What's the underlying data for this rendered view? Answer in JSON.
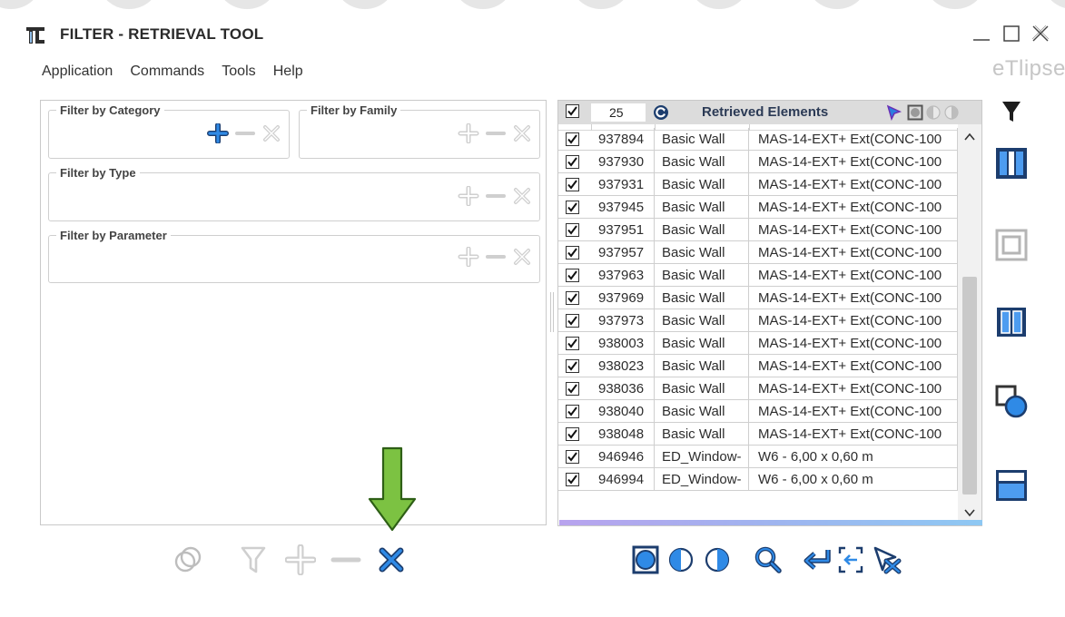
{
  "window": {
    "title": "FILTER - RETRIEVAL TOOL",
    "brand": "eTlipse"
  },
  "menu": [
    "Application",
    "Commands",
    "Tools",
    "Help"
  ],
  "filters": {
    "category": "Filter by Category",
    "family": "Filter by Family",
    "type": "Filter by Type",
    "parameter": "Filter by Parameter"
  },
  "grid": {
    "count": "25",
    "title": "Retrieved Elements",
    "rows": [
      {
        "id": "937894",
        "family": "Basic Wall",
        "type": "MAS-14-EXT+ Ext(CONC-100"
      },
      {
        "id": "937930",
        "family": "Basic Wall",
        "type": "MAS-14-EXT+ Ext(CONC-100"
      },
      {
        "id": "937931",
        "family": "Basic Wall",
        "type": "MAS-14-EXT+ Ext(CONC-100"
      },
      {
        "id": "937945",
        "family": "Basic Wall",
        "type": "MAS-14-EXT+ Ext(CONC-100"
      },
      {
        "id": "937951",
        "family": "Basic Wall",
        "type": "MAS-14-EXT+ Ext(CONC-100"
      },
      {
        "id": "937957",
        "family": "Basic Wall",
        "type": "MAS-14-EXT+ Ext(CONC-100"
      },
      {
        "id": "937963",
        "family": "Basic Wall",
        "type": "MAS-14-EXT+ Ext(CONC-100"
      },
      {
        "id": "937969",
        "family": "Basic Wall",
        "type": "MAS-14-EXT+ Ext(CONC-100"
      },
      {
        "id": "937973",
        "family": "Basic Wall",
        "type": "MAS-14-EXT+ Ext(CONC-100"
      },
      {
        "id": "938003",
        "family": "Basic Wall",
        "type": "MAS-14-EXT+ Ext(CONC-100"
      },
      {
        "id": "938023",
        "family": "Basic Wall",
        "type": "MAS-14-EXT+ Ext(CONC-100"
      },
      {
        "id": "938036",
        "family": "Basic Wall",
        "type": "MAS-14-EXT+ Ext(CONC-100"
      },
      {
        "id": "938040",
        "family": "Basic Wall",
        "type": "MAS-14-EXT+ Ext(CONC-100"
      },
      {
        "id": "938048",
        "family": "Basic Wall",
        "type": "MAS-14-EXT+ Ext(CONC-100"
      },
      {
        "id": "946946",
        "family": "ED_Window-",
        "type": "W6 - 6,00 x 0,60 m"
      },
      {
        "id": "946994",
        "family": "ED_Window-",
        "type": "W6 - 6,00 x 0,60 m"
      }
    ]
  },
  "colors": {
    "accent_blue": "#1f7fe0",
    "dark_blue": "#1c3d6e",
    "icon_gray": "#bdbdbd",
    "annotation_green": "#7cc242"
  },
  "icons": {
    "window_controls": [
      "minimize-icon",
      "maximize-icon",
      "close-icon"
    ],
    "right_toolbar": [
      "funnel-icon",
      "columns-icon",
      "square-outline-icon",
      "double-columns-icon",
      "shape-overlap-icon",
      "panel-icon"
    ],
    "bottom_left": [
      "overlap-circles-icon",
      "funnel-icon",
      "plus-icon",
      "minus-icon",
      "close-icon"
    ],
    "bottom_right": [
      "select-square-icon",
      "half-circle-left-icon",
      "half-circle-right-icon",
      "zoom-icon",
      "return-icon",
      "target-icon",
      "cursor-cross-icon"
    ]
  }
}
